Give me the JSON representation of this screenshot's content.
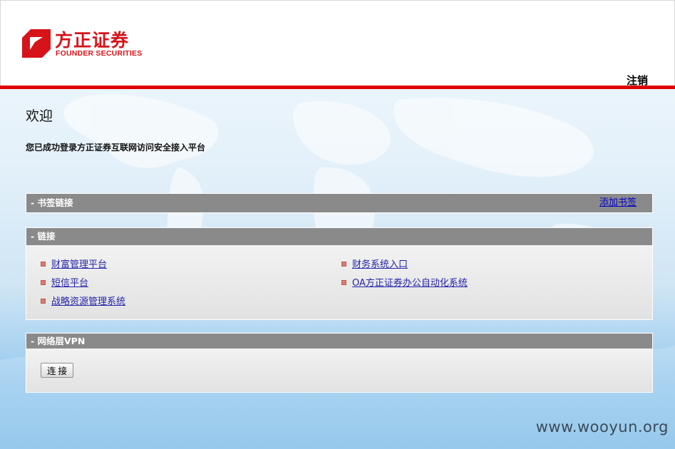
{
  "header": {
    "logo_cn": "方正证券",
    "logo_en": "FOUNDER SECURITIES",
    "logout_label": "注销"
  },
  "welcome": {
    "title": "欢迎",
    "subtitle": "您已成功登录方正证券互联网访问安全接入平台"
  },
  "bookmarks_panel": {
    "title": "- 书签链接",
    "add_label": "添加书签"
  },
  "links_panel": {
    "title": "- 链接",
    "links": [
      "财富管理平台",
      "短信平台",
      "战略资源管理系统",
      "财务系统入口",
      "OA方正证券办公自动化系统"
    ]
  },
  "vpn_panel": {
    "title": "- 网络层VPN",
    "connect_label": "连接"
  },
  "watermark": "www.wooyun.org",
  "colors": {
    "brand_red": "#d7131a",
    "header_line": "#e00000",
    "panel_header": "#8a8a8a",
    "link": "#2424aa"
  }
}
